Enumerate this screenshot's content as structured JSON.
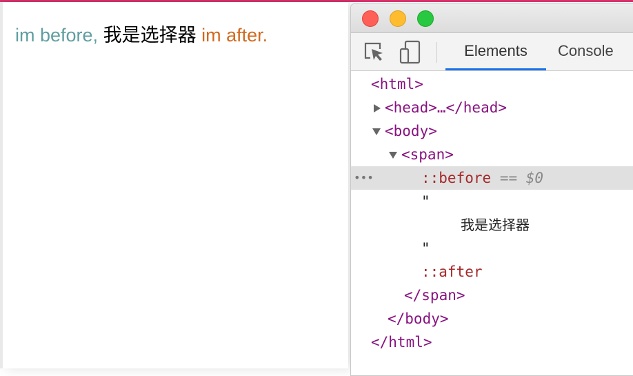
{
  "page": {
    "before": "im before,",
    "content": "我是选择器",
    "after": "im after."
  },
  "colors": {
    "before": "#5f9ea0",
    "after": "#d2691e",
    "tab_underline": "#1a73e8"
  },
  "devtools": {
    "tabs": [
      {
        "label": "Elements",
        "active": true
      },
      {
        "label": "Console",
        "active": false
      }
    ],
    "icons": [
      "inspect-element-icon",
      "device-toolbar-icon"
    ],
    "tree": {
      "html_open": "<html>",
      "head": "<head>…</head>",
      "body_open": "<body>",
      "span_open": "<span>",
      "before": "::before",
      "selected_marker": "== $0",
      "dots": "•••",
      "quote": "\"",
      "text": "我是选择器",
      "after": "::after",
      "span_close": "</span>",
      "body_close": "</body>",
      "html_close": "</html>"
    }
  }
}
